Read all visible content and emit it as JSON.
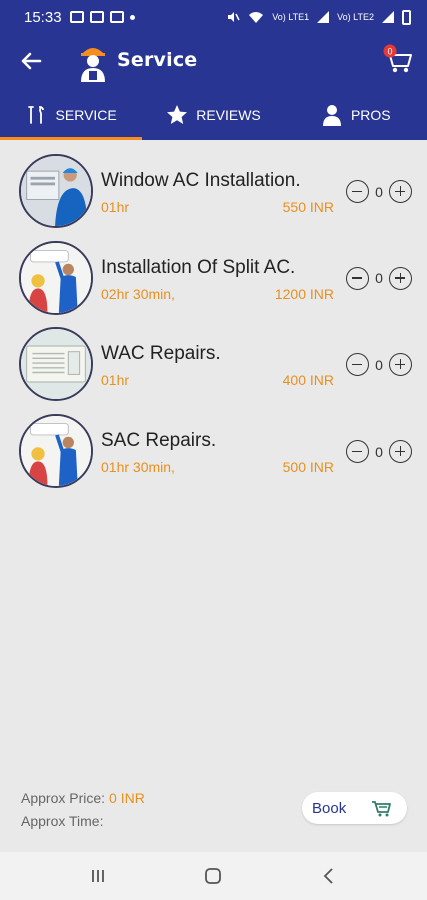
{
  "status_bar": {
    "time": "15:33",
    "signal_text_1": "Vo) LTE1",
    "signal_text_2": "Vo) LTE2"
  },
  "header": {
    "title": "Service",
    "cart_count": "0"
  },
  "tabs": [
    {
      "label": "SERVICE",
      "icon": "tools-icon",
      "active": true
    },
    {
      "label": "REVIEWS",
      "icon": "star-icon",
      "active": false
    },
    {
      "label": "PROS",
      "icon": "person-icon",
      "active": false
    }
  ],
  "services": [
    {
      "name": "Window AC Installation.",
      "duration": "01hr",
      "price": "550 INR",
      "qty": "0"
    },
    {
      "name": "Installation Of Split AC.",
      "duration": "02hr 30min,",
      "price": "1200 INR",
      "qty": "0"
    },
    {
      "name": "WAC Repairs.",
      "duration": "01hr",
      "price": "400 INR",
      "qty": "0"
    },
    {
      "name": "SAC Repairs.",
      "duration": "01hr 30min,",
      "price": "500 INR",
      "qty": "0"
    }
  ],
  "footer": {
    "approx_price_label": "Approx Price:",
    "approx_price_value": "0 INR",
    "approx_time_label": "Approx Time:",
    "approx_time_value": "",
    "book_label": "Book"
  },
  "colors": {
    "primary": "#283593",
    "accent": "#e8901e",
    "background": "#e9e9e9"
  }
}
